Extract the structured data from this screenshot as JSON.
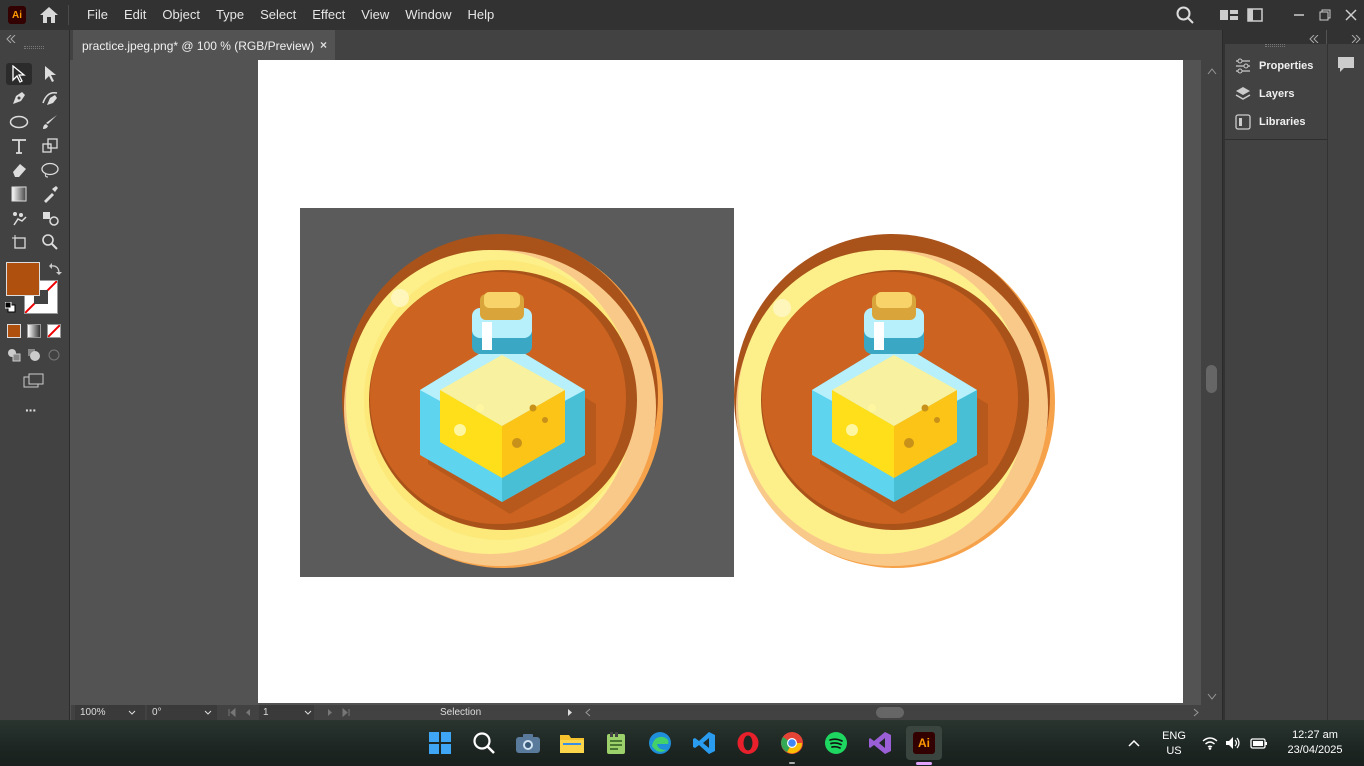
{
  "app": {
    "logo": "Ai",
    "menu": [
      "File",
      "Edit",
      "Object",
      "Type",
      "Select",
      "Effect",
      "View",
      "Window",
      "Help"
    ]
  },
  "document": {
    "tab_title": "practice.jpeg.png* @ 100 % (RGB/Preview)",
    "close_glyph": "×"
  },
  "toolbar": {
    "more_glyph": "···",
    "fill_color": "#b0500e"
  },
  "statusbar": {
    "zoom": "100%",
    "rotation": "0°",
    "artboard_number": "1",
    "tool_status": "Selection"
  },
  "right_panel": {
    "tabs": [
      {
        "label": "Properties",
        "icon": "properties-icon"
      },
      {
        "label": "Layers",
        "icon": "layers-icon"
      },
      {
        "label": "Libraries",
        "icon": "libraries-icon"
      }
    ]
  },
  "taskbar": {
    "apps": [
      "windows-start",
      "search",
      "camera",
      "file-explorer",
      "notepad",
      "edge",
      "vscode",
      "opera",
      "chrome",
      "spotify",
      "visual-studio",
      "illustrator"
    ],
    "language_line1": "ENG",
    "language_line2": "US",
    "time": "12:27 am",
    "date": "23/04/2025"
  },
  "colors": {
    "app_bg": "#535353",
    "panel": "#424242",
    "menubar": "#323232",
    "accent_orange": "#ff9a00"
  }
}
